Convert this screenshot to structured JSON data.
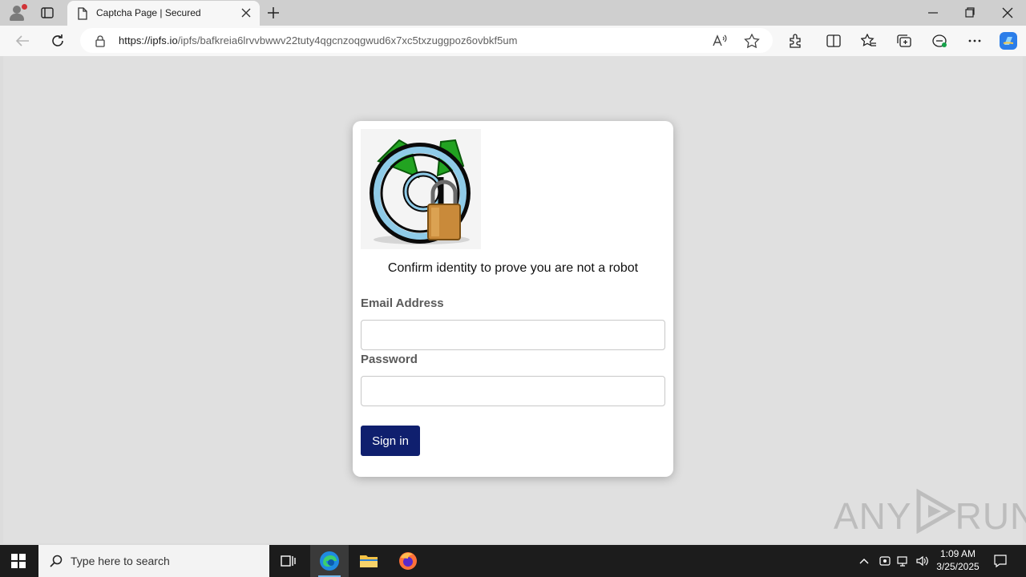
{
  "browser": {
    "tab_title": "Captcha Page | Secured",
    "url_host": "https://ipfs.io",
    "url_path": "/ipfs/bafkreia6lrvvbwwv22tuty4qgcnzoqgwud6x7xc5txzuggpoz6ovbkf5um",
    "accent_color": "#0078d4"
  },
  "page": {
    "heading": "Confirm identity to prove you are not a robot",
    "email_label": "Email Address",
    "email_value": "",
    "password_label": "Password",
    "password_value": "",
    "signin_label": "Sign in",
    "button_color": "#0f1f6e",
    "logo_icon": "email-at-padlock-icon"
  },
  "watermark": {
    "text_left": "ANY",
    "text_right": "RUN"
  },
  "taskbar": {
    "search_placeholder": "Type here to search",
    "time": "1:09 AM",
    "date": "3/25/2025"
  }
}
